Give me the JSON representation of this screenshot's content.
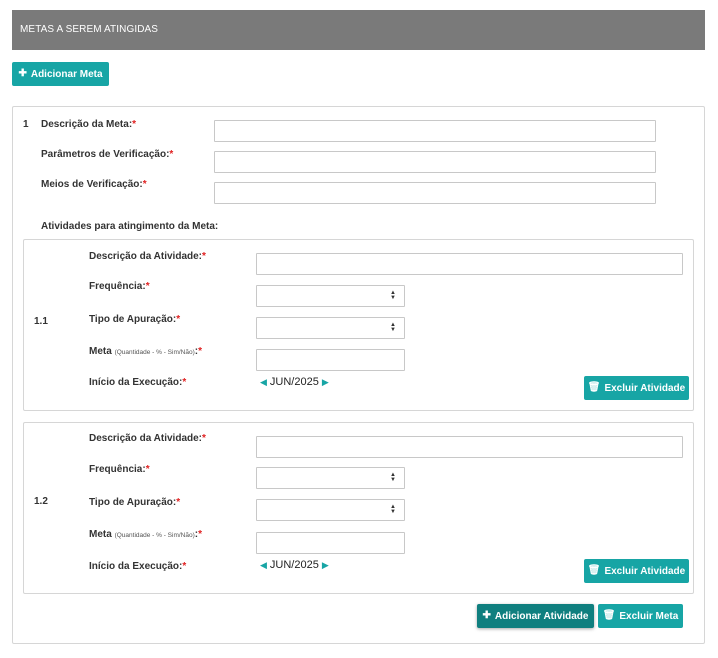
{
  "header": {
    "title": "METAS A SEREM ATINGIDAS"
  },
  "buttons": {
    "add_meta": "Adicionar Meta",
    "add_activity": "Adicionar Atividade",
    "delete_meta": "Excluir Meta",
    "delete_activity": "Excluir Atividade"
  },
  "meta": {
    "number": "1",
    "fields": {
      "descricao": "Descrição da Meta:",
      "parametros": "Parâmetros de Verificação:",
      "meios": "Meios de Verificação:"
    },
    "required_mark": "*",
    "activities_title": "Atividades para atingimento da Meta:"
  },
  "activity_labels": {
    "descricao": "Descrição da Atividade:",
    "frequencia": "Frequência:",
    "tipo": "Tipo de Apuração:",
    "meta": "Meta",
    "meta_hint": "(Quantidade - % - Sim/Não)",
    "meta_colon": ":",
    "inicio": "Início da Execução:"
  },
  "activities": [
    {
      "number": "1.1",
      "start": "JUN/2025"
    },
    {
      "number": "1.2",
      "start": "JUN/2025"
    }
  ],
  "icons": {
    "plus": "plus-icon",
    "trash": "trash-icon",
    "prev": "triangle-left-icon",
    "next": "triangle-right-icon",
    "sort": "sort-arrows-icon"
  },
  "colors": {
    "accent": "#17a5a5",
    "header_bg": "#7a7a7a",
    "required": "#e02020"
  }
}
